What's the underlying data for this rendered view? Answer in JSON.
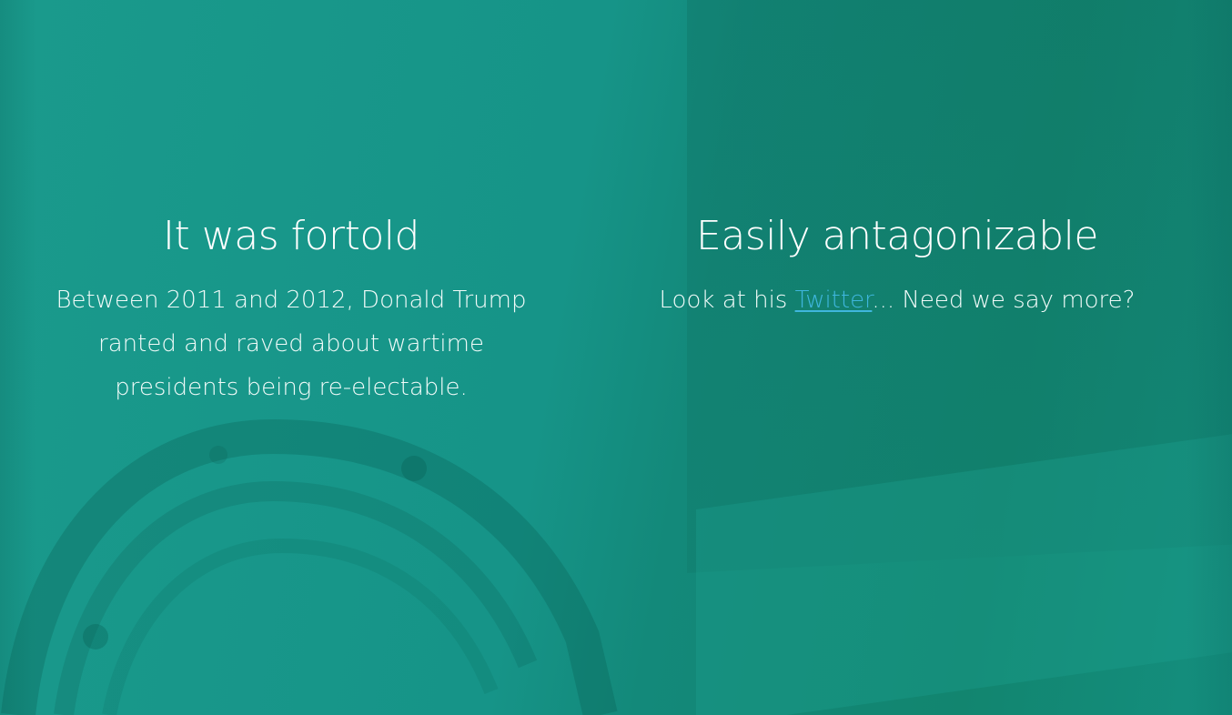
{
  "colors": {
    "background": "#169488",
    "text": "#ffffff",
    "link": "#3fb6dd"
  },
  "left_column": {
    "heading": "It was fortold",
    "body": "Between 2011 and 2012, Donald Trump ranted and raved about wartime presidents being re-electable."
  },
  "right_column": {
    "heading": "Easily antagonizable",
    "body_before": "Look at his ",
    "link_text": "Twitter",
    "body_after": "... Need we say more?"
  }
}
